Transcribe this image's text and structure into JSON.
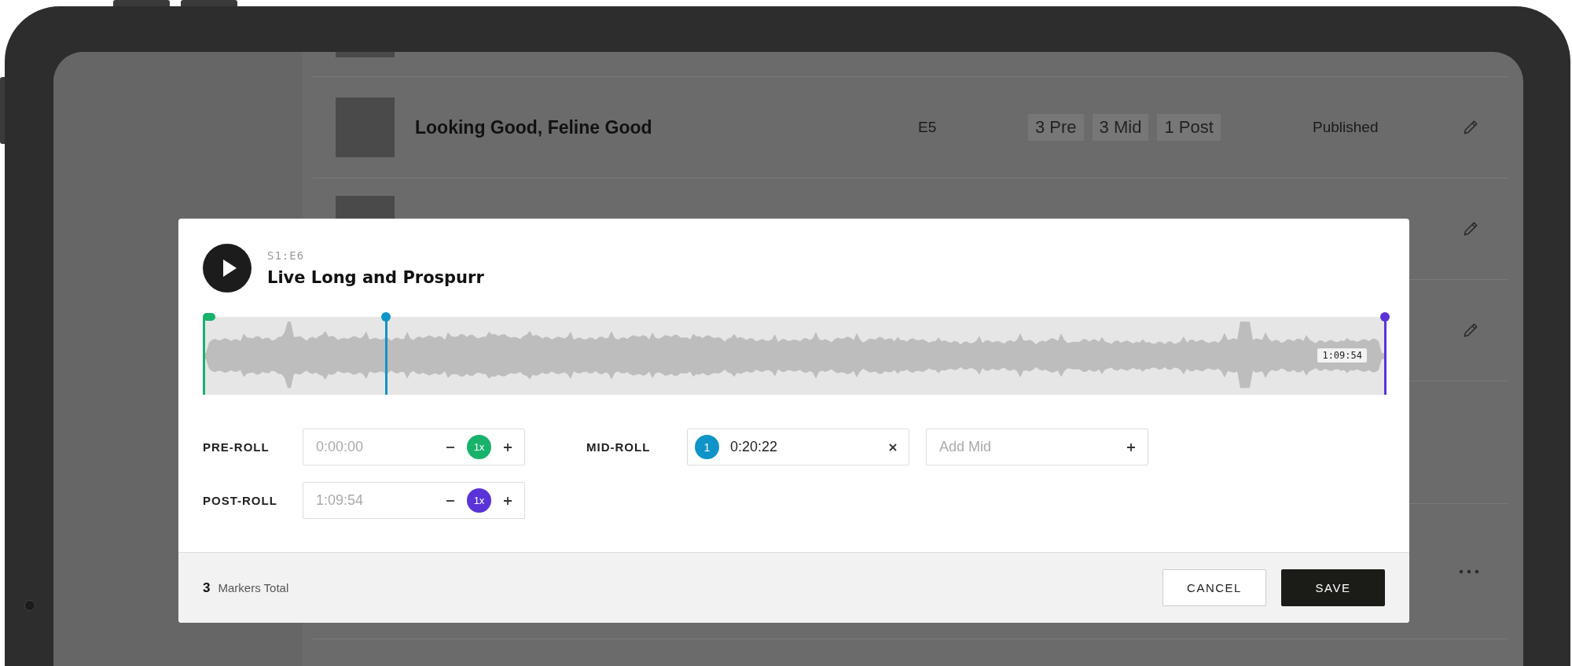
{
  "episode_list": {
    "rows": [
      {
        "kind": "sliver",
        "thumbnail": true
      },
      {
        "kind": "episode",
        "thumbnail": true,
        "title": "Looking Good, Feline Good",
        "episode": "E5",
        "tags": [
          "3 Pre",
          "3 Mid",
          "1 Post"
        ],
        "status": "Published"
      },
      {
        "kind": "edit",
        "thumbnail": true
      },
      {
        "kind": "edit",
        "thumbnail": false
      },
      {
        "kind": "gap",
        "thumbnail": false
      },
      {
        "kind": "more",
        "thumbnail": false
      }
    ]
  },
  "modal": {
    "episode_code": "S1:E6",
    "title": "Live Long and Prospurr",
    "waveform": {
      "duration_label": "1:09:54",
      "markers": [
        {
          "kind": "start",
          "color": "#18b26b",
          "level": 0
        },
        {
          "kind": "point",
          "color": "#0f94c8",
          "level": 0.155
        },
        {
          "kind": "point",
          "color": "#5a33d8",
          "level": 1
        }
      ]
    },
    "pre_roll": {
      "label": "PRE-ROLL",
      "placeholder": "0:00:00",
      "count": "1x",
      "color": "#18b26b"
    },
    "mid_roll": {
      "label": "MID-ROLL",
      "markers": [
        {
          "number": "1",
          "value": "0:20:22",
          "color": "#0f94c8"
        }
      ],
      "add_placeholder": "Add Mid"
    },
    "post_roll": {
      "label": "POST-ROLL",
      "placeholder": "1:09:54",
      "count": "1x",
      "color": "#5a33d8"
    },
    "footer": {
      "total": "3",
      "total_label": "Markers Total",
      "buttons": [
        {
          "label": "CANCEL",
          "kind": "secondary"
        },
        {
          "label": "SAVE",
          "kind": "primary"
        }
      ]
    }
  }
}
